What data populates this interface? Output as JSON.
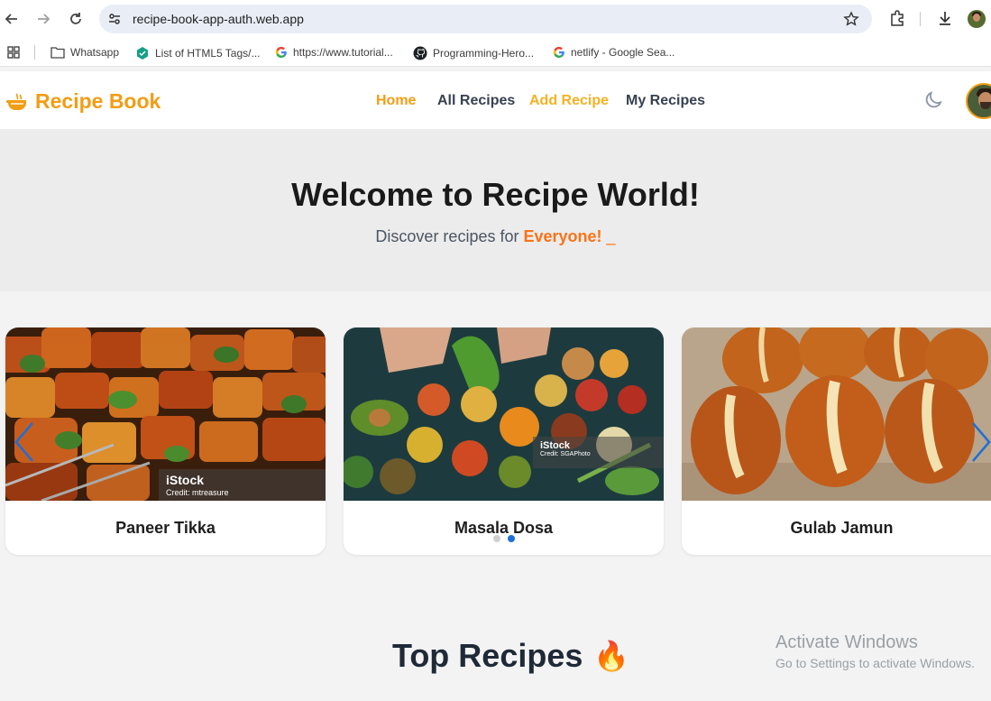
{
  "browser": {
    "url": "recipe-book-app-auth.web.app",
    "bookmarks": [
      {
        "label": "Whatsapp",
        "icon": "folder-icon"
      },
      {
        "label": "List of HTML5 Tags/...",
        "icon": "site-icon"
      },
      {
        "label": "https://www.tutorial...",
        "icon": "google-icon"
      },
      {
        "label": "Programming-Hero...",
        "icon": "github-icon"
      },
      {
        "label": "netlify - Google Sea...",
        "icon": "google-icon"
      }
    ]
  },
  "navbar": {
    "brand": "Recipe Book",
    "links": [
      {
        "label": "Home",
        "color": "#f29d14"
      },
      {
        "label": "All Recipes",
        "color": "#374151"
      },
      {
        "label": "Add Recipe",
        "color": "#f5b120"
      },
      {
        "label": "My Recipes",
        "color": "#374151"
      }
    ]
  },
  "hero": {
    "title": "Welcome to Recipe World!",
    "subtitle_prefix": "Discover recipes for",
    "subtitle_accent": "Everyone!",
    "cursor": "_"
  },
  "slider": {
    "cards": [
      {
        "name": "Paneer Tikka",
        "watermark": "iStock",
        "credit": "Credit: mtreasure"
      },
      {
        "name": "Masala Dosa",
        "watermark": "iStock",
        "credit": "Credit: SGAPhoto"
      },
      {
        "name": "Gulab Jamun"
      }
    ],
    "active_dot": 2,
    "dot_count": 2
  },
  "section": {
    "title": "Top Recipes",
    "emoji": "🔥"
  },
  "os_watermark": {
    "line1": "Activate Windows",
    "line2": "Go to Settings to activate Windows."
  },
  "colors": {
    "brand": "#f29d14",
    "accent": "#f97316",
    "dot_active": "#1d6fd8"
  }
}
